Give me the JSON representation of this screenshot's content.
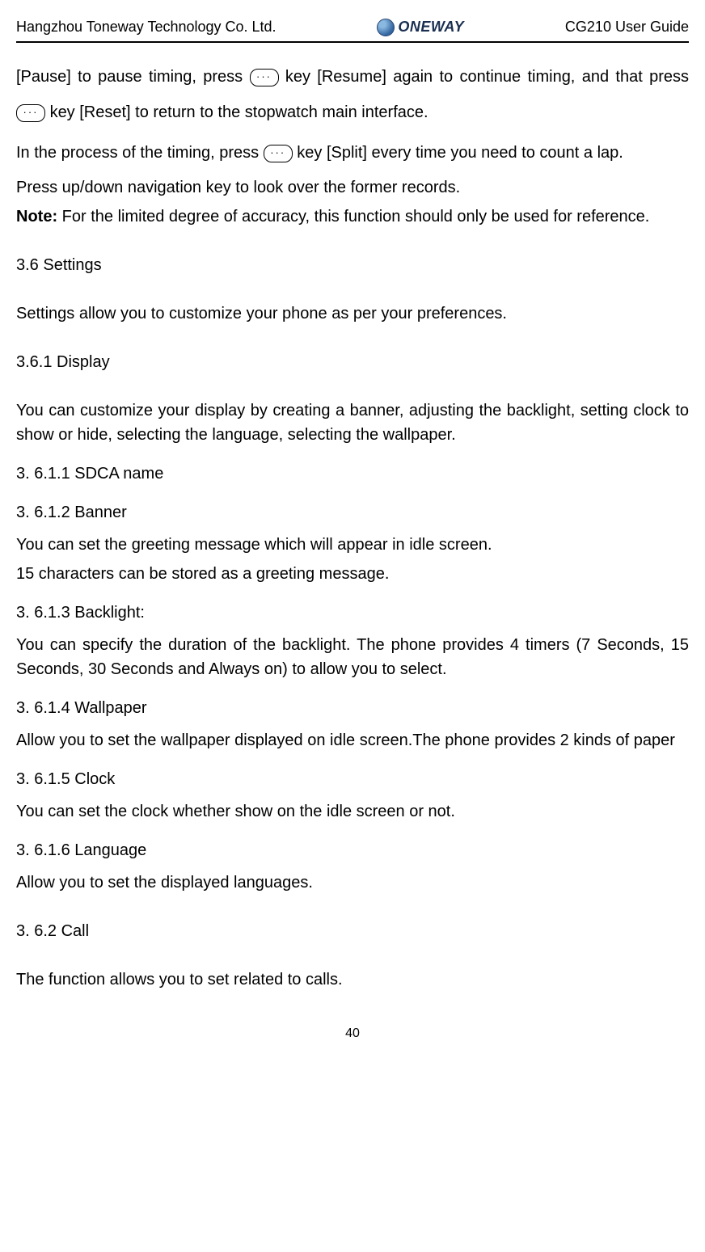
{
  "header": {
    "company": "Hangzhou Toneway Technology Co. Ltd.",
    "logo": "ONEWAY",
    "doc_title": "CG210 User Guide"
  },
  "body": {
    "p1_a": "[Pause] to pause timing, press ",
    "p1_b": " key [Resume] again to continue timing, and that press ",
    "p1_c": " key [Reset] to return to the stopwatch main interface.",
    "p2_a": "In the process of the timing, press ",
    "p2_b": " key [Split] every time you need to count a lap.",
    "p3": "Press up/down navigation key to look over the former records.",
    "note_label": "Note:",
    "note_text": " For the limited degree of accuracy, this function should only be used for reference.",
    "s36": "3.6 Settings",
    "s36_text": "Settings allow you to customize your phone as per your preferences.",
    "s361": "3.6.1 Display",
    "s361_text": "You can customize your display by creating a banner, adjusting the backlight, setting clock to show or hide, selecting the language, selecting the wallpaper.",
    "s3611": "3. 6.1.1 SDCA name",
    "s3612": "3. 6.1.2 Banner",
    "s3612_text1": "You can set the greeting message which will appear in idle screen.",
    "s3612_text2": "15 characters can be stored as a greeting message.",
    "s3613": "3. 6.1.3 Backlight:",
    "s3613_text": "You can specify the duration of the backlight. The phone provides 4 timers (7 Seconds, 15 Seconds, 30 Seconds and Always on) to allow you to select.",
    "s3614": "3. 6.1.4 Wallpaper",
    "s3614_text": "Allow you to set the wallpaper displayed on idle screen.The phone provides 2 kinds of paper",
    "s3615": "3. 6.1.5 Clock",
    "s3615_text": "You can set the clock whether show on the idle screen or not.",
    "s3616": "3. 6.1.6 Language",
    "s3616_text": "Allow you to set the displayed languages.",
    "s362": "3. 6.2 Call",
    "s362_text": "The function allows you to set related to calls."
  },
  "footer": {
    "page": "40"
  },
  "icons": {
    "dots": "···"
  }
}
